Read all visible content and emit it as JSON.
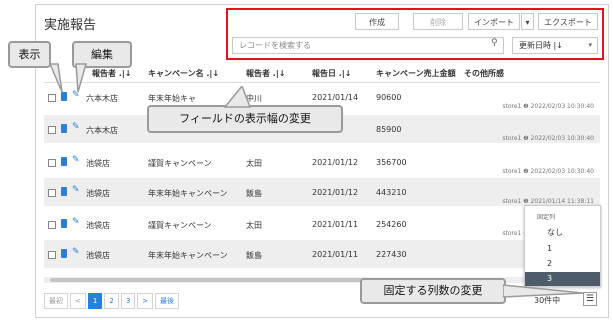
{
  "page": {
    "title": "実施報告"
  },
  "toolbar": {
    "create": "作成",
    "delete": "削除",
    "import": "インポート",
    "import_caret": "▾",
    "export": "エクスポート",
    "search_placeholder": "レコードを検索する",
    "search_icon": "search-icon",
    "sort_label": "更新日時 |↓",
    "sort_caret": "▾"
  },
  "table": {
    "headers": [
      "報告者 .|↓",
      "キャンペーン名 .|↓",
      "報告者 .|↓",
      "報告日 .|↓",
      "キャンペーン売上金額",
      "その他所感"
    ],
    "rows": [
      {
        "store": "六本木店",
        "campaign": "年末年始キャ",
        "reporter": "中川",
        "date": "2021/01/14",
        "amount": "90600",
        "meta": "store1 ❷ 2022/02/03 10:30:40"
      },
      {
        "store": "六本木店",
        "campaign": "",
        "reporter": "",
        "date": "3",
        "amount": "85900",
        "meta": "store1 ❷ 2022/02/03 10:30:40"
      },
      {
        "store": "池袋店",
        "campaign": "謹賀キャンペーン",
        "reporter": "太田",
        "date": "2021/01/12",
        "amount": "356700",
        "meta": "store1 ❷ 2022/02/03 10:30:40"
      },
      {
        "store": "池袋店",
        "campaign": "年末年始キャンペーン",
        "reporter": "飯島",
        "date": "2021/01/12",
        "amount": "443210",
        "meta": "store1 ❷ 2021/01/14 11:38:11"
      },
      {
        "store": "池袋店",
        "campaign": "謹賀キャンペーン",
        "reporter": "太田",
        "date": "2021/01/11",
        "amount": "254260",
        "meta": "store1 ❷ 2022/02/03 10:30:40"
      },
      {
        "store": "池袋店",
        "campaign": "年末年始キャンペーン",
        "reporter": "飯島",
        "date": "2021/01/11",
        "amount": "227430",
        "meta": "store"
      }
    ]
  },
  "pager": {
    "first": "最初",
    "prev": "<",
    "pages": [
      "1",
      "2",
      "3"
    ],
    "next": ">",
    "last": "最後",
    "current": "1"
  },
  "footer": {
    "total_label": "30件中",
    "menu_icon": "menu-icon"
  },
  "freeze_dropdown": {
    "heading": "固定列",
    "options": [
      "なし",
      "1",
      "2",
      "3"
    ],
    "selected": "3"
  },
  "callouts": {
    "view": "表示",
    "edit": "編集",
    "field_width": "フィールドの表示幅の変更",
    "freeze_columns": "固定する列数の変更"
  }
}
